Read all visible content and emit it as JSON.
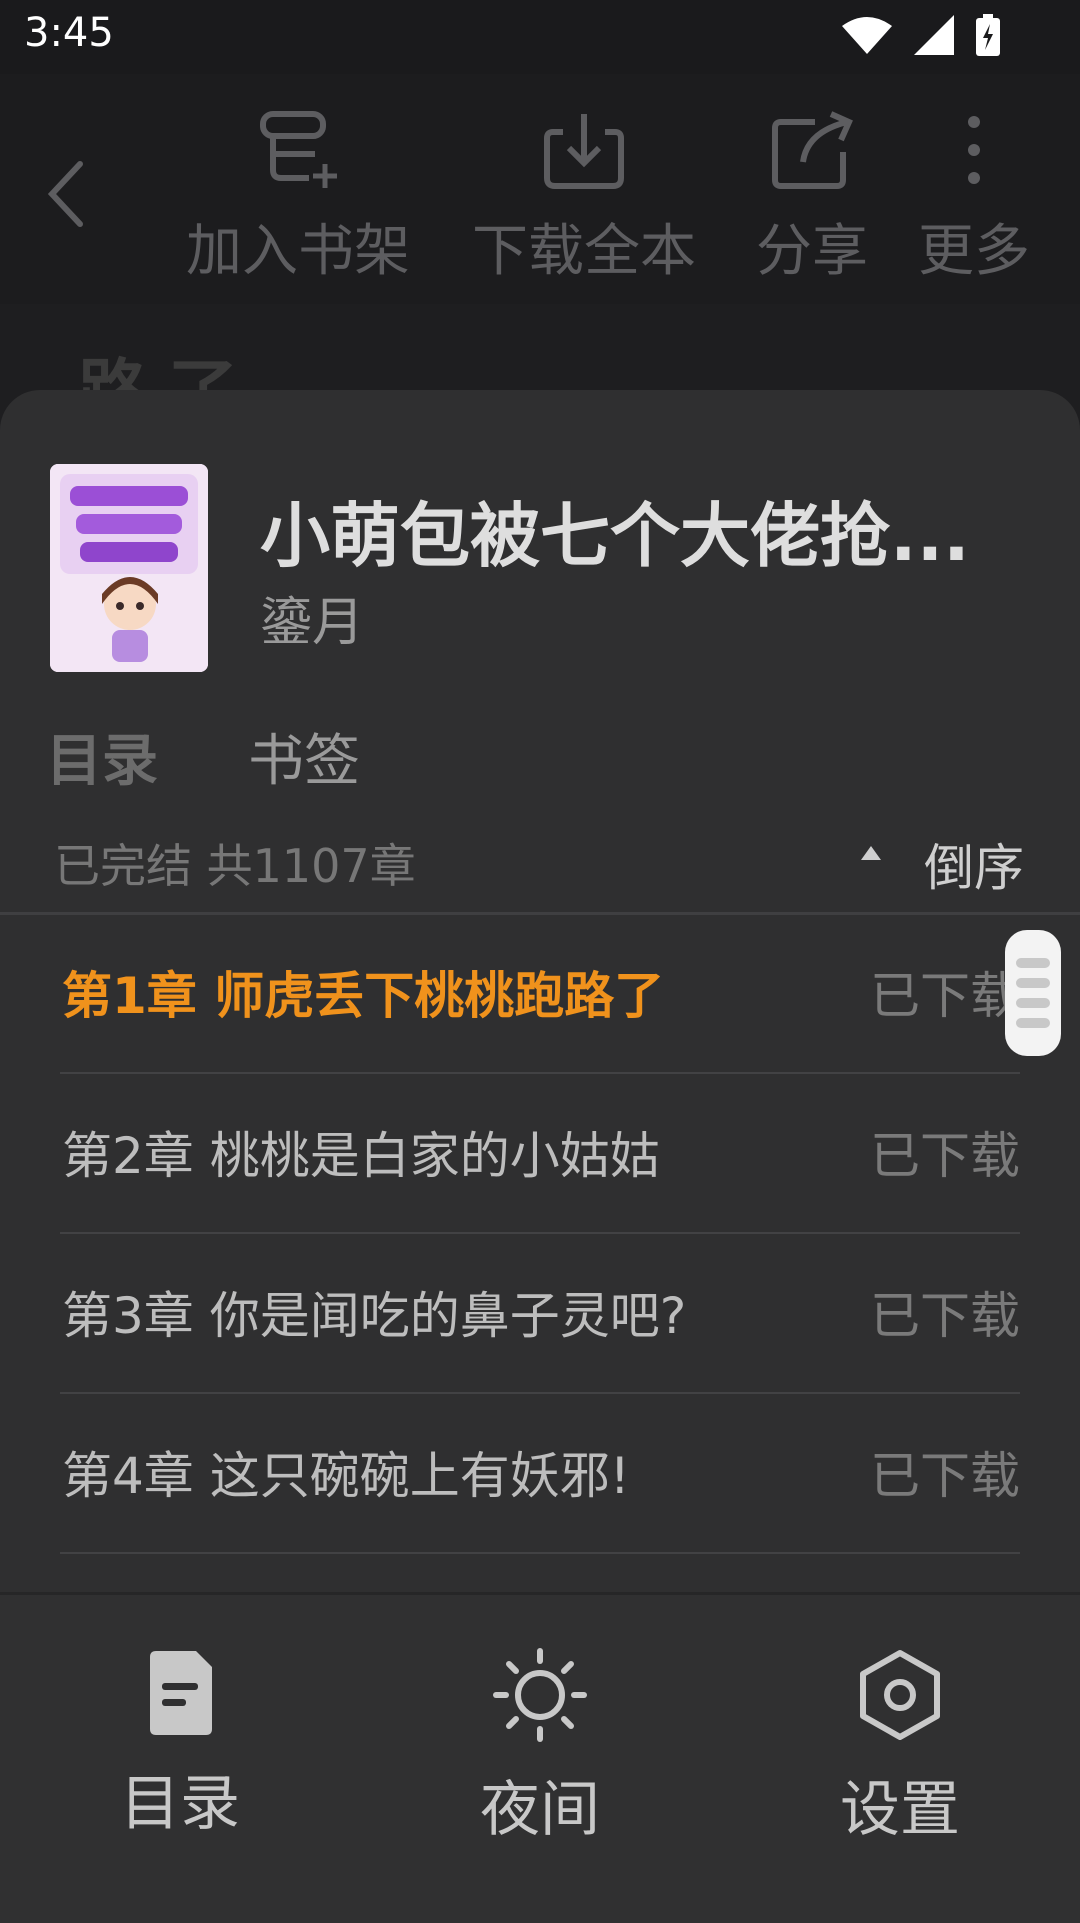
{
  "status_bar": {
    "time": "3:45"
  },
  "toolbar": {
    "items": [
      {
        "label": "加入书架",
        "icon": "add-to-shelf-icon"
      },
      {
        "label": "下载全本",
        "icon": "download-icon"
      },
      {
        "label": "分享",
        "icon": "share-icon"
      },
      {
        "label": "更多",
        "icon": "more-vertical-icon"
      }
    ]
  },
  "background_text": "路了",
  "book": {
    "title": "小萌包被七个大佬抢...",
    "author": "鎏月"
  },
  "tabs": {
    "catalog": "目录",
    "bookmarks": "书签"
  },
  "catalog": {
    "summary": "已完结 共1107章",
    "sort_label": "倒序",
    "chapters": [
      {
        "title": "第1章 师虎丢下桃桃跑路了",
        "status": "已下载"
      },
      {
        "title": "第2章 桃桃是白家的小姑姑",
        "status": "已下载"
      },
      {
        "title": "第3章 你是闻吃的鼻子灵吧?",
        "status": "已下载"
      },
      {
        "title": "第4章 这只碗碗上有妖邪!",
        "status": "已下载"
      }
    ]
  },
  "bottom_bar": {
    "items": [
      {
        "label": "目录",
        "icon": "catalog-icon"
      },
      {
        "label": "夜间",
        "icon": "sun-icon"
      },
      {
        "label": "设置",
        "icon": "settings-icon"
      }
    ]
  },
  "colors": {
    "accent": "#f0921c",
    "sheet_bg": "#2f2f30",
    "toolbar_bg": "#1c1c1e"
  }
}
